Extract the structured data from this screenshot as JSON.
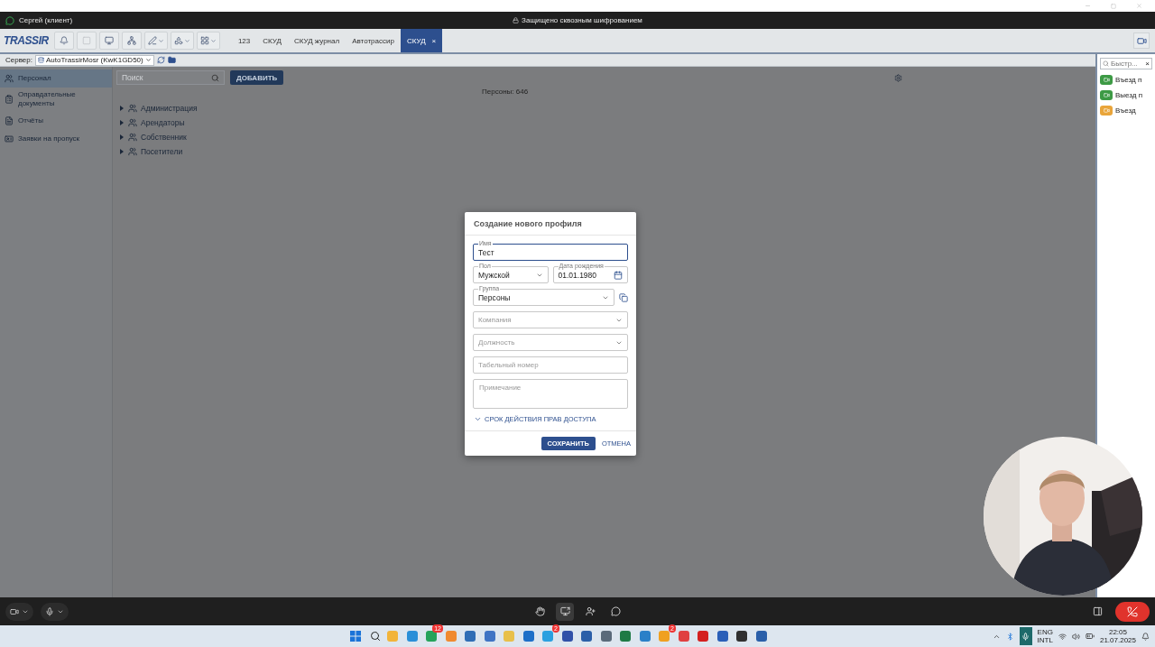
{
  "call_window": {
    "caller": "Сергей (клиент)",
    "encryption_note": "Защищено сквозным шифрованием"
  },
  "toolbar": {
    "logo": "TRASSIR",
    "tabs": [
      {
        "label": "123",
        "selected": false,
        "closable": false
      },
      {
        "label": "СКУД",
        "selected": false,
        "closable": false
      },
      {
        "label": "СКУД журнал",
        "selected": false,
        "closable": false
      },
      {
        "label": "Автотрассир",
        "selected": false,
        "closable": false
      },
      {
        "label": "СКУД",
        "selected": true,
        "closable": true
      }
    ],
    "close_glyph": "×"
  },
  "server_bar": {
    "label": "Сервер:",
    "server": "AutoTrassirMosr (KwK1GD50)"
  },
  "sidebar": {
    "items": [
      {
        "label": "Персонал",
        "selected": true
      },
      {
        "label": "Оправдательные документы",
        "selected": false
      },
      {
        "label": "Отчёты",
        "selected": false
      },
      {
        "label": "Заявки на пропуск",
        "selected": false
      }
    ]
  },
  "content": {
    "search": {
      "placeholder": "Поиск"
    },
    "add_button": "ДОБАВИТЬ",
    "count": "Персоны: 646",
    "tree": [
      {
        "label": "Администрация",
        "expanded": false
      },
      {
        "label": "Арендаторы",
        "expanded": false
      },
      {
        "label": "Собственник",
        "expanded": false
      },
      {
        "label": "Посетители",
        "expanded": false
      }
    ]
  },
  "dialog": {
    "title": "Создание нового профиля",
    "rows": [
      [
        {
          "kind": "text",
          "label": "Имя",
          "value": "Тест",
          "focused": true
        }
      ],
      [
        {
          "kind": "select",
          "label": "Пол",
          "value": "Мужской",
          "focused": false
        },
        {
          "kind": "date",
          "label": "Дата рождения",
          "value": "01.01.1980",
          "focused": false
        }
      ],
      [
        {
          "kind": "select",
          "label": "Группа",
          "value": "Персоны",
          "focused": false
        },
        {
          "kind": "copy"
        }
      ],
      [
        {
          "kind": "select",
          "placeholder": "Компания",
          "focused": false
        }
      ],
      [
        {
          "kind": "select",
          "placeholder": "Должность",
          "focused": false
        }
      ],
      [
        {
          "kind": "text",
          "placeholder": "Табельный номер",
          "focused": false
        }
      ],
      [
        {
          "kind": "textarea",
          "placeholder": "Примечание",
          "focused": false
        }
      ]
    ],
    "expander": {
      "label": "СРОК ДЕЙСТВИЯ ПРАВ ДОСТУПА",
      "expanded": false
    },
    "save": "СОХРАНИТЬ",
    "cancel": "ОТМЕНА"
  },
  "right_panel": {
    "search": {
      "placeholder": "Быстр..."
    },
    "clear_glyph": "×",
    "cameras": [
      {
        "label": "Въезд п",
        "color": "#3d9a45"
      },
      {
        "label": "Выезд п",
        "color": "#3d9a45"
      },
      {
        "label": "Въезд",
        "color": "#e9a53a"
      }
    ]
  },
  "taskbar": {
    "apps": [
      {
        "color": "#f2b43a"
      },
      {
        "color": "#2a8fd8"
      },
      {
        "color": "#25a35a",
        "badge": "12"
      },
      {
        "color": "#f08a30"
      },
      {
        "color": "#2f6db5"
      },
      {
        "color": "#3f74c4"
      },
      {
        "color": "#e8c04a"
      },
      {
        "color": "#1d6fc8"
      },
      {
        "color": "#2aa0e0",
        "badge": "2"
      },
      {
        "color": "#3050a8"
      },
      {
        "color": "#2a5fa8"
      },
      {
        "color": "#5a6a7a"
      },
      {
        "color": "#1e7a45"
      },
      {
        "color": "#2a80c8"
      },
      {
        "color": "#f0a020",
        "badge": "2"
      },
      {
        "color": "#e04040"
      },
      {
        "color": "#d42020"
      },
      {
        "color": "#2a5fb8"
      },
      {
        "color": "#303030"
      },
      {
        "color": "#2a5fa9"
      }
    ],
    "language": "ENG",
    "layout": "INTL",
    "time": "22:05",
    "date": "21.07.2025"
  }
}
